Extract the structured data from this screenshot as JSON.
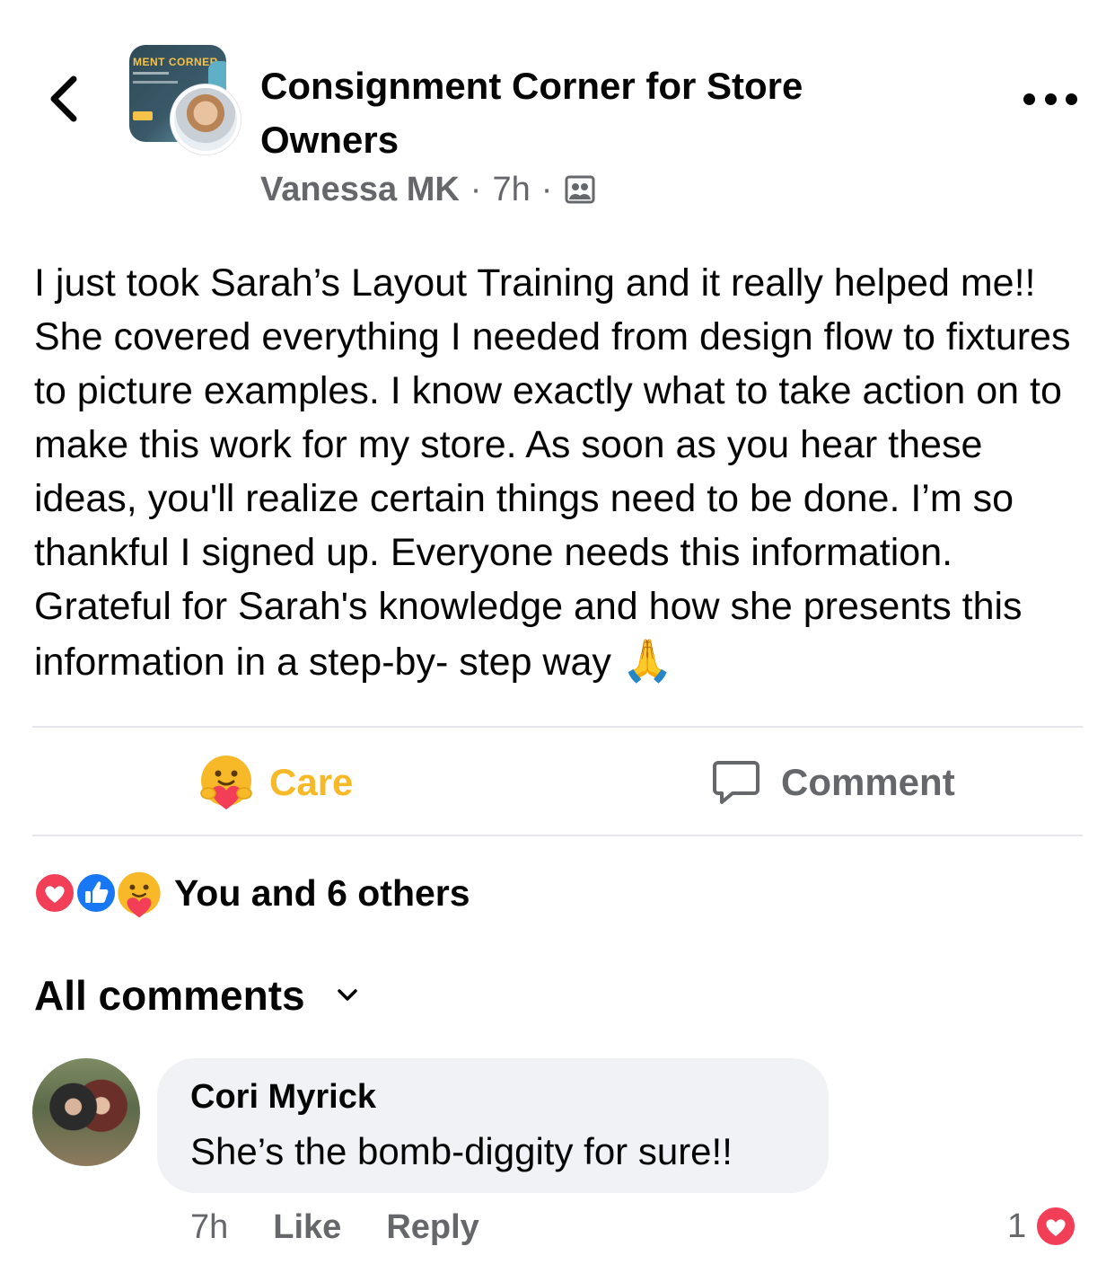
{
  "header": {
    "group_name": "Consignment Corner for Store Owners",
    "group_avatar_text": "MENT CORNER",
    "author": "Vanessa MK",
    "separator": "·",
    "time": "7h",
    "audience_icon": "members-icon"
  },
  "post": {
    "text": "I just took Sarah’s Layout Training and it really helped me!! She covered everything I needed from design flow to fixtures to picture examples. I know exactly what to take action on to make this work for my store. As soon as you hear these ideas, you'll realize certain things need to be done. I’m so thankful I signed up. Everyone needs this information. Grateful for Sarah's knowledge and how she presents this information in a step-by- step way",
    "emoji": "🙏"
  },
  "actions": {
    "care_label": "Care",
    "care_color": "#F7B928",
    "comment_label": "Comment"
  },
  "reactions": {
    "summary": "You and 6 others",
    "icons": [
      "love-icon",
      "like-icon",
      "care-icon"
    ]
  },
  "comments": {
    "filter_label": "All comments",
    "items": [
      {
        "author": "Cori Myrick",
        "text": "She’s the bomb-diggity for sure!!",
        "time": "7h",
        "like_label": "Like",
        "reply_label": "Reply",
        "reaction_count": "1",
        "reaction_icon": "love-icon"
      }
    ]
  },
  "colors": {
    "text_primary": "#050505",
    "text_secondary": "#65676B",
    "divider": "#E4E6EB",
    "bubble": "#F0F2F5",
    "love": "#F33E58",
    "like": "#1877F2"
  }
}
